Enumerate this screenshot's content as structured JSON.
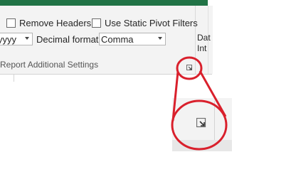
{
  "options": {
    "remove_headers_label": "Remove Headers",
    "use_static_pivot_filters_label": "Use Static Pivot Filters",
    "date_format_value": "yyyy",
    "decimal_format_label": "Decimal format",
    "decimal_format_value": "Comma"
  },
  "group": {
    "label": "Report Additional Settings"
  },
  "next_group": {
    "label_line1": "Dat",
    "label_line2": "Int"
  },
  "icons": {
    "launcher": "dialog-launcher-icon",
    "dropdown": "chevron-down-icon"
  },
  "colors": {
    "ribbon_accent": "#217346",
    "highlight": "#d9202c"
  }
}
